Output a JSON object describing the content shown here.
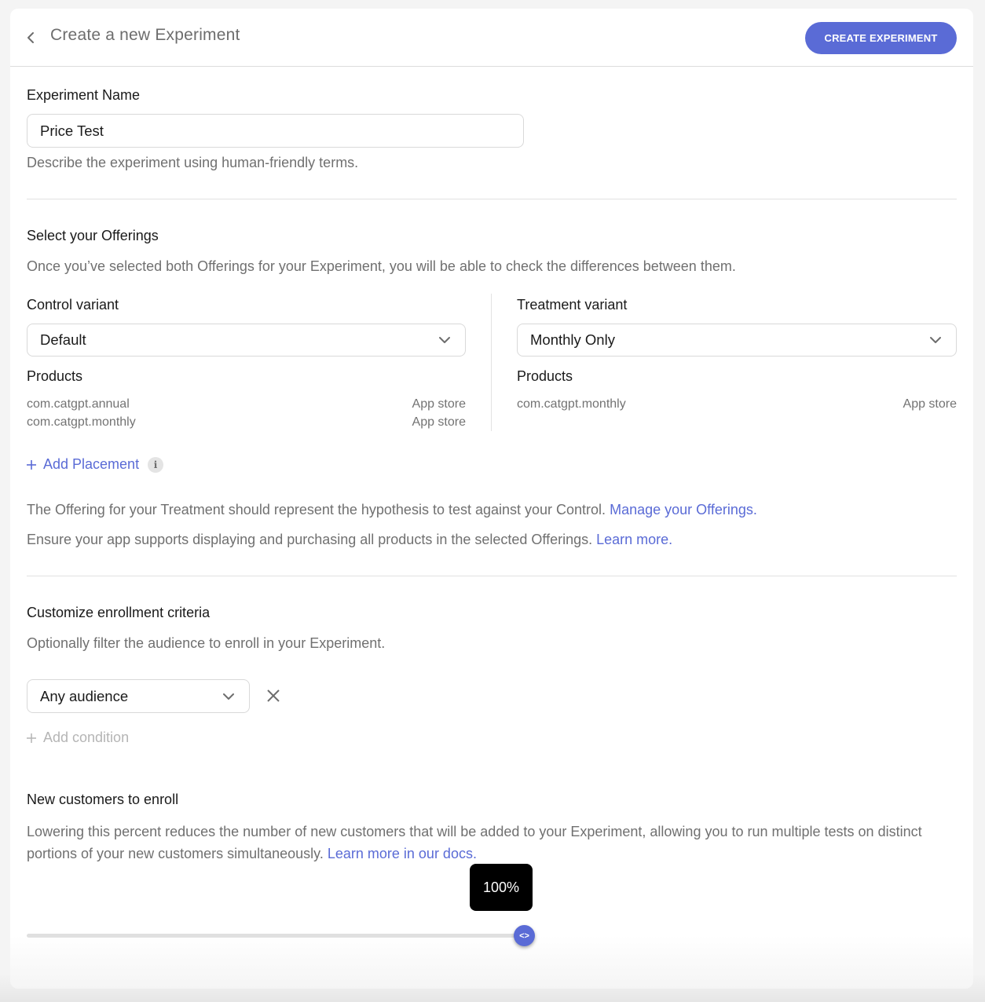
{
  "header": {
    "title": "Create a new Experiment",
    "create_button": "CREATE EXPERIMENT"
  },
  "experiment_name": {
    "label": "Experiment Name",
    "value": "Price Test",
    "help": "Describe the experiment using human-friendly terms."
  },
  "offerings": {
    "heading": "Select your Offerings",
    "help": "Once you’ve selected both Offerings for your Experiment, you will be able to check the differences between them.",
    "control": {
      "label": "Control variant",
      "selected": "Default",
      "products_label": "Products",
      "products": [
        {
          "id": "com.catgpt.annual",
          "store": "App store"
        },
        {
          "id": "com.catgpt.monthly",
          "store": "App store"
        }
      ]
    },
    "treatment": {
      "label": "Treatment variant",
      "selected": "Monthly Only",
      "products_label": "Products",
      "products": [
        {
          "id": "com.catgpt.monthly",
          "store": "App store"
        }
      ]
    },
    "add_placement": "Add Placement",
    "info_glyph": "i",
    "note1_text": "The Offering for your Treatment should represent the hypothesis to test against your Control.",
    "note1_link": "Manage your Offerings.",
    "note2_text": "Ensure your app supports displaying and purchasing all products in the selected Offerings.",
    "note2_link": "Learn more."
  },
  "enrollment": {
    "heading": "Customize enrollment criteria",
    "help": "Optionally filter the audience to enroll in your Experiment.",
    "audience_selected": "Any audience",
    "add_condition": "Add condition"
  },
  "new_customers": {
    "heading": "New customers to enroll",
    "help": "Lowering this percent reduces the number of new customers that will be added to your Experiment, allowing you to run multiple tests on distinct portions of your new customers simultaneously.",
    "help_link": "Learn more in our docs.",
    "percent_label": "100%",
    "percent_value": 100,
    "thumb_glyph": "<>"
  },
  "colors": {
    "accent": "#5a6bd6",
    "muted_text": "#707070"
  }
}
